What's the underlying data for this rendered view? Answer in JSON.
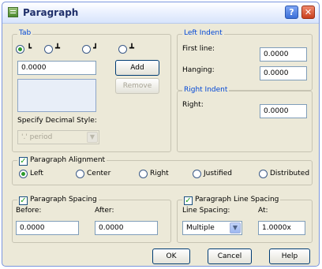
{
  "window": {
    "title": "Paragraph",
    "help_glyph": "?",
    "close_glyph": "✕"
  },
  "tab": {
    "legend": "Tab",
    "icons": [
      "┗",
      "┻",
      "┛",
      "┻"
    ],
    "position_value": "0.0000",
    "add_label": "Add",
    "remove_label": "Remove",
    "decimal_style_label": "Specify Decimal Style:",
    "decimal_style_value": "'.' period"
  },
  "left_indent": {
    "legend": "Left Indent",
    "first_line_label": "First line:",
    "first_line_value": "0.0000",
    "hanging_label": "Hanging:",
    "hanging_value": "0.0000"
  },
  "right_indent": {
    "legend": "Right Indent",
    "right_label": "Right:",
    "right_value": "0.0000"
  },
  "alignment": {
    "legend": "Paragraph Alignment",
    "checked": true,
    "options": [
      "Left",
      "Center",
      "Right",
      "Justified",
      "Distributed"
    ],
    "selected": "Left"
  },
  "spacing": {
    "legend": "Paragraph Spacing",
    "checked": true,
    "before_label": "Before:",
    "before_value": "0.0000",
    "after_label": "After:",
    "after_value": "0.0000"
  },
  "line_spacing": {
    "legend": "Paragraph Line Spacing",
    "checked": true,
    "line_spacing_label": "Line Spacing:",
    "line_spacing_value": "Multiple",
    "at_label": "At:",
    "at_value": "1.0000x"
  },
  "buttons": {
    "ok": "OK",
    "cancel": "Cancel",
    "help": "Help"
  }
}
